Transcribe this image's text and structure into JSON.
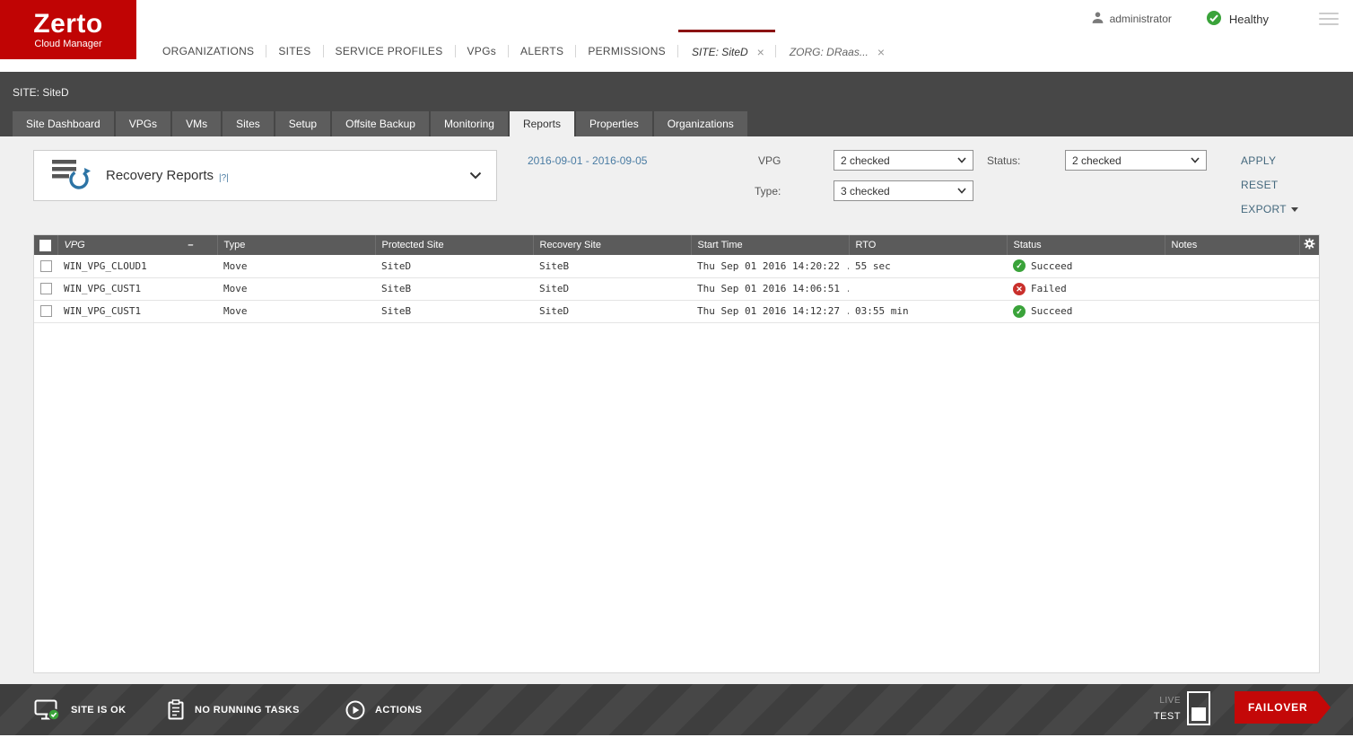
{
  "brand": {
    "name": "Zerto",
    "subtitle": "Cloud Manager"
  },
  "topbar": {
    "nav_items": [
      "ORGANIZATIONS",
      "SITES",
      "SERVICE PROFILES",
      "VPGs",
      "ALERTS",
      "PERMISSIONS"
    ],
    "doc_tabs": [
      {
        "label": "SITE: SiteD",
        "close": "×"
      },
      {
        "label": "ZORG: DRaas...",
        "close": "×"
      }
    ],
    "user": "administrator",
    "health_status": "Healthy"
  },
  "page": {
    "title": "SITE: SiteD"
  },
  "nav_tabs": [
    "Site Dashboard",
    "VPGs",
    "VMs",
    "Sites",
    "Setup",
    "Offsite Backup",
    "Monitoring",
    "Reports",
    "Properties",
    "Organizations"
  ],
  "filters": {
    "report_title": "Recovery Reports",
    "report_help": "|?|",
    "date_range": "2016-09-01 - 2016-09-05",
    "vpg_label": "VPG",
    "vpg_value": "2 checked",
    "status_label": "Status:",
    "status_value": "2 checked",
    "type_label": "Type:",
    "type_value": "3 checked",
    "apply_label": "APPLY",
    "reset_label": "RESET",
    "export_label": "EXPORT"
  },
  "table": {
    "columns": [
      "VPG",
      "Type",
      "Protected Site",
      "Recovery Site",
      "Start Time",
      "RTO",
      "Status",
      "Notes"
    ],
    "sort_indicator": "–",
    "rows": [
      {
        "vpg": "WIN_VPG_CLOUD1",
        "type": "Move",
        "protected_site": "SiteD",
        "recovery_site": "SiteB",
        "start_time": "Thu Sep 01 2016 14:20:22 ...",
        "rto": "55 sec",
        "status": "Succeed",
        "notes": ""
      },
      {
        "vpg": "WIN_VPG_CUST1",
        "type": "Move",
        "protected_site": "SiteB",
        "recovery_site": "SiteD",
        "start_time": "Thu Sep 01 2016 14:06:51 ...",
        "rto": "",
        "status": "Failed",
        "notes": ""
      },
      {
        "vpg": "WIN_VPG_CUST1",
        "type": "Move",
        "protected_site": "SiteB",
        "recovery_site": "SiteD",
        "start_time": "Thu Sep 01 2016 14:12:27 ...",
        "rto": "03:55 min",
        "status": "Succeed",
        "notes": ""
      }
    ]
  },
  "footer": {
    "site_status": "SITE IS OK",
    "tasks_status": "NO RUNNING TASKS",
    "actions_label": "ACTIONS",
    "live_label": "LIVE",
    "test_label": "TEST",
    "failover_label": "FAILOVER"
  },
  "icons": {
    "success_glyph": "✓",
    "failure_glyph": "✕"
  },
  "colors": {
    "brand_red": "#c00404",
    "healthy_green": "#3aa33a",
    "failed_red": "#c9302c",
    "link_blue": "#4a7ca3"
  }
}
